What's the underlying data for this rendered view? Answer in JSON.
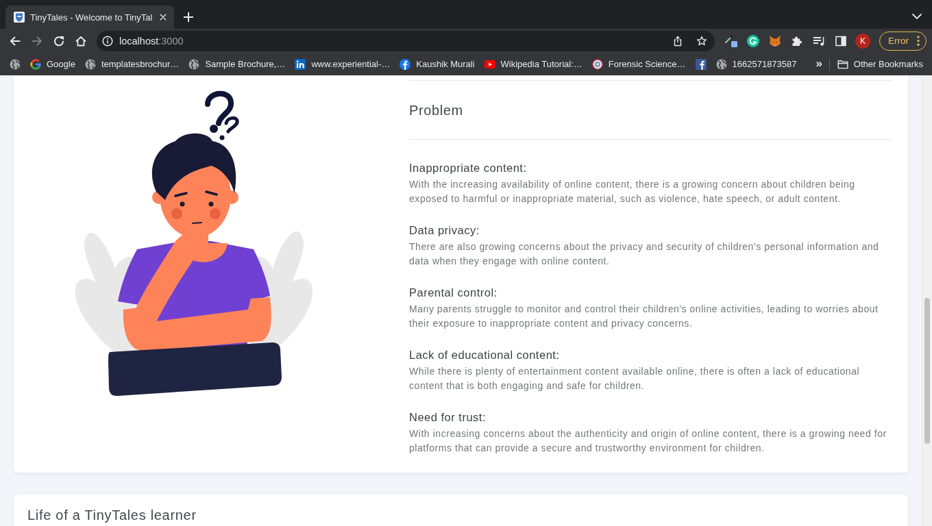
{
  "browser": {
    "tabs": [
      {
        "title": "TinyTales - Welcome to TinyTal",
        "selected": true
      }
    ],
    "nav_buttons": [
      {
        "kind": "back",
        "disabled": false
      },
      {
        "kind": "forward",
        "disabled": true
      },
      {
        "kind": "reload",
        "disabled": false
      },
      {
        "kind": "home",
        "disabled": false
      }
    ],
    "address": {
      "host": "localhost",
      "port": ":3000"
    },
    "extensions": [
      {
        "kind": "eyedropper"
      },
      {
        "kind": "gcircle"
      },
      {
        "kind": "fox"
      },
      {
        "kind": "puzzle"
      },
      {
        "kind": "playlist"
      },
      {
        "kind": "sidepanel"
      }
    ],
    "profile": {
      "initial": "K"
    },
    "error_button": {
      "label": "Error"
    },
    "bookmarks": [
      {
        "kind": "globe"
      },
      {
        "kind": "google",
        "label": "Google"
      },
      {
        "kind": "globe",
        "label": "templatesbrochur…"
      },
      {
        "kind": "globe",
        "label": "Sample Brochure,…"
      },
      {
        "kind": "linkedin",
        "label": "www.experiential-…"
      },
      {
        "kind": "facebook",
        "label": "Kaushik Murali"
      },
      {
        "kind": "youtube",
        "label": "Wikipedia Tutorial:…"
      },
      {
        "kind": "seal",
        "label": "Forensic Science…"
      },
      {
        "kind": "fbsquare"
      },
      {
        "kind": "globe",
        "label": "1662571873587"
      }
    ],
    "more_bookmarks": "»",
    "other_bookmarks": "Other Bookmarks"
  },
  "page": {
    "section": {
      "title": "Problem",
      "items": [
        {
          "title": "Inappropriate content:",
          "text": "With the increasing availability of online content, there is a growing concern about children being exposed to harmful or inappropriate material, such as violence, hate speech, or adult content."
        },
        {
          "title": "Data privacy:",
          "text": "There are also growing concerns about the privacy and security of children's personal information and data when they engage with online content."
        },
        {
          "title": "Parental control:",
          "text": "Many parents struggle to monitor and control their children's online activities, leading to worries about their exposure to inappropriate content and privacy concerns."
        },
        {
          "title": "Lack of educational content:",
          "text": "While there is plenty of entertainment content available online, there is often a lack of educational content that is both engaging and safe for children."
        },
        {
          "title": "Need for trust:",
          "text": "With increasing concerns about the authenticity and origin of online content, there is a growing need for platforms that can provide a secure and trustworthy environment for children."
        }
      ]
    },
    "next_section": {
      "title": "Life of a TinyTales learner"
    }
  }
}
